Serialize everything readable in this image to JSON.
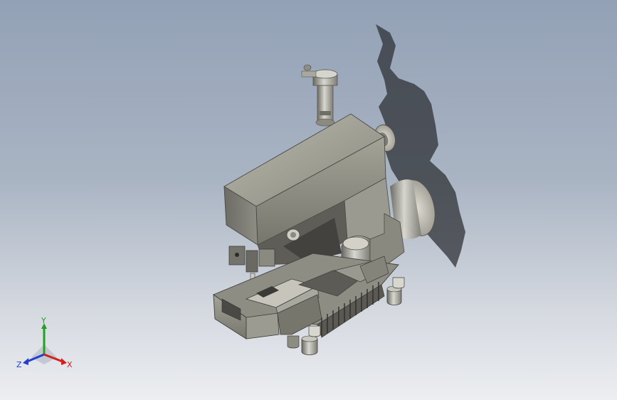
{
  "viewport": {
    "background_top": "#93a1b6",
    "background_bottom": "#eceef1",
    "model": "sewing-machine-assembly"
  },
  "triad": {
    "x_label": "X",
    "y_label": "Y",
    "z_label": "Z",
    "x_color": "#d02020",
    "y_color": "#22a022",
    "z_color": "#2040d0"
  }
}
